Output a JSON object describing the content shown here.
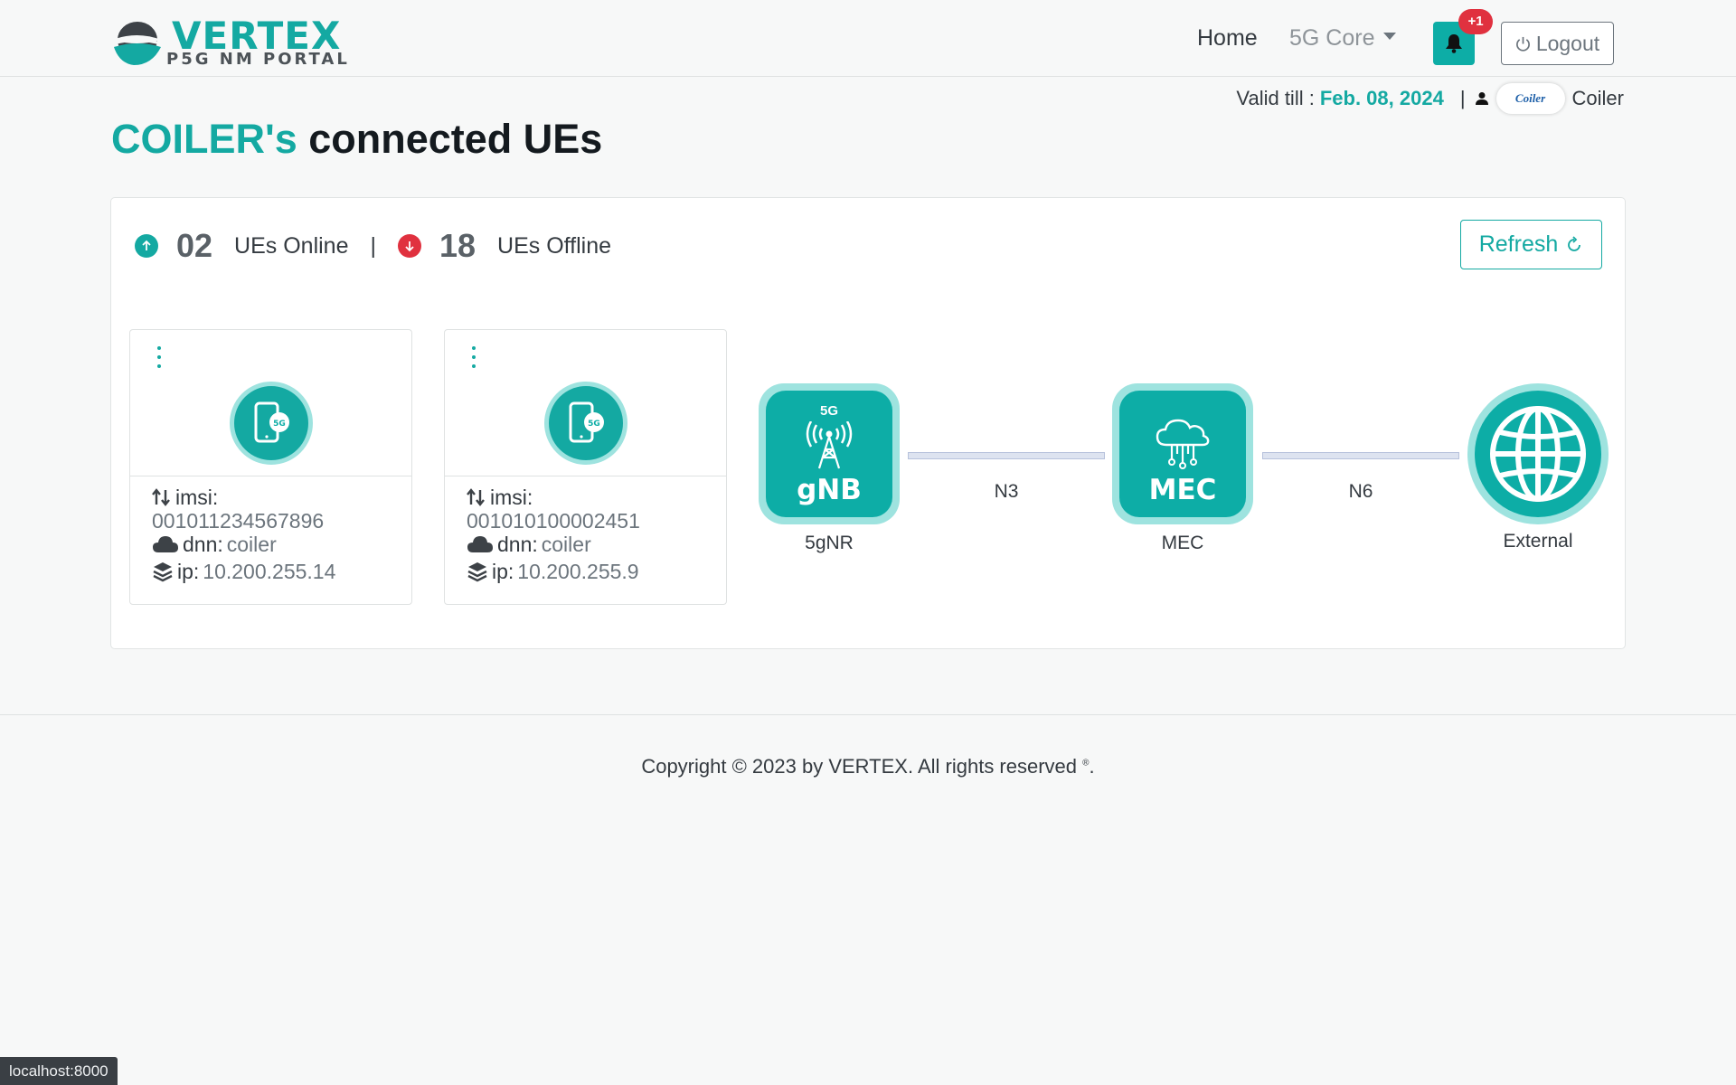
{
  "brand": {
    "title": "VERTEX",
    "subtitle": "P5G NM PORTAL",
    "teal": "#14a9a2",
    "accent_light": "#9ee3df"
  },
  "nav": {
    "home": "Home",
    "core": "5G Core",
    "notification_badge": "+1",
    "logout": "Logout"
  },
  "account": {
    "valid_label": "Valid till :",
    "valid_date": "Feb. 08, 2024",
    "separator": "|",
    "org_logo_text": "Coiler",
    "username": "Coiler"
  },
  "page": {
    "title_org": "COILER's",
    "title_rest": "connected UEs"
  },
  "stats": {
    "online_count": "02",
    "online_label": "UEs Online",
    "separator": "|",
    "offline_count": "18",
    "offline_label": "UEs Offline",
    "refresh_label": "Refresh"
  },
  "ues": [
    {
      "imsi_label": "imsi:",
      "imsi": "001011234567896",
      "dnn_label": "dnn:",
      "dnn": "coiler",
      "ip_label": "ip:",
      "ip": "10.200.255.14"
    },
    {
      "imsi_label": "imsi:",
      "imsi": "001010100002451",
      "dnn_label": "dnn:",
      "dnn": "coiler",
      "ip_label": "ip:",
      "ip": "10.200.255.9"
    }
  ],
  "topology": {
    "gnb": {
      "badge": "5G",
      "title": "gNB",
      "label": "5gNR"
    },
    "mec": {
      "title": "MEC",
      "label": "MEC"
    },
    "external": {
      "label": "External"
    },
    "links": {
      "n3": "N3",
      "n6": "N6"
    }
  },
  "footer": {
    "copyright": "Copyright © 2023 by VERTEX. All rights reserved",
    "mark": "®",
    "suffix": "."
  },
  "status_bar": {
    "url": "localhost:8000"
  },
  "icons": [
    "vertex-logo-icon",
    "bell-icon",
    "power-icon",
    "user-icon",
    "arrow-up-circle-icon",
    "arrow-down-circle-icon",
    "refresh-icon",
    "kebab-menu-icon",
    "phone-5g-icon",
    "sort-icon",
    "cloud-icon",
    "layers-icon",
    "antenna-tower-icon",
    "cloud-network-icon",
    "globe-icon"
  ]
}
